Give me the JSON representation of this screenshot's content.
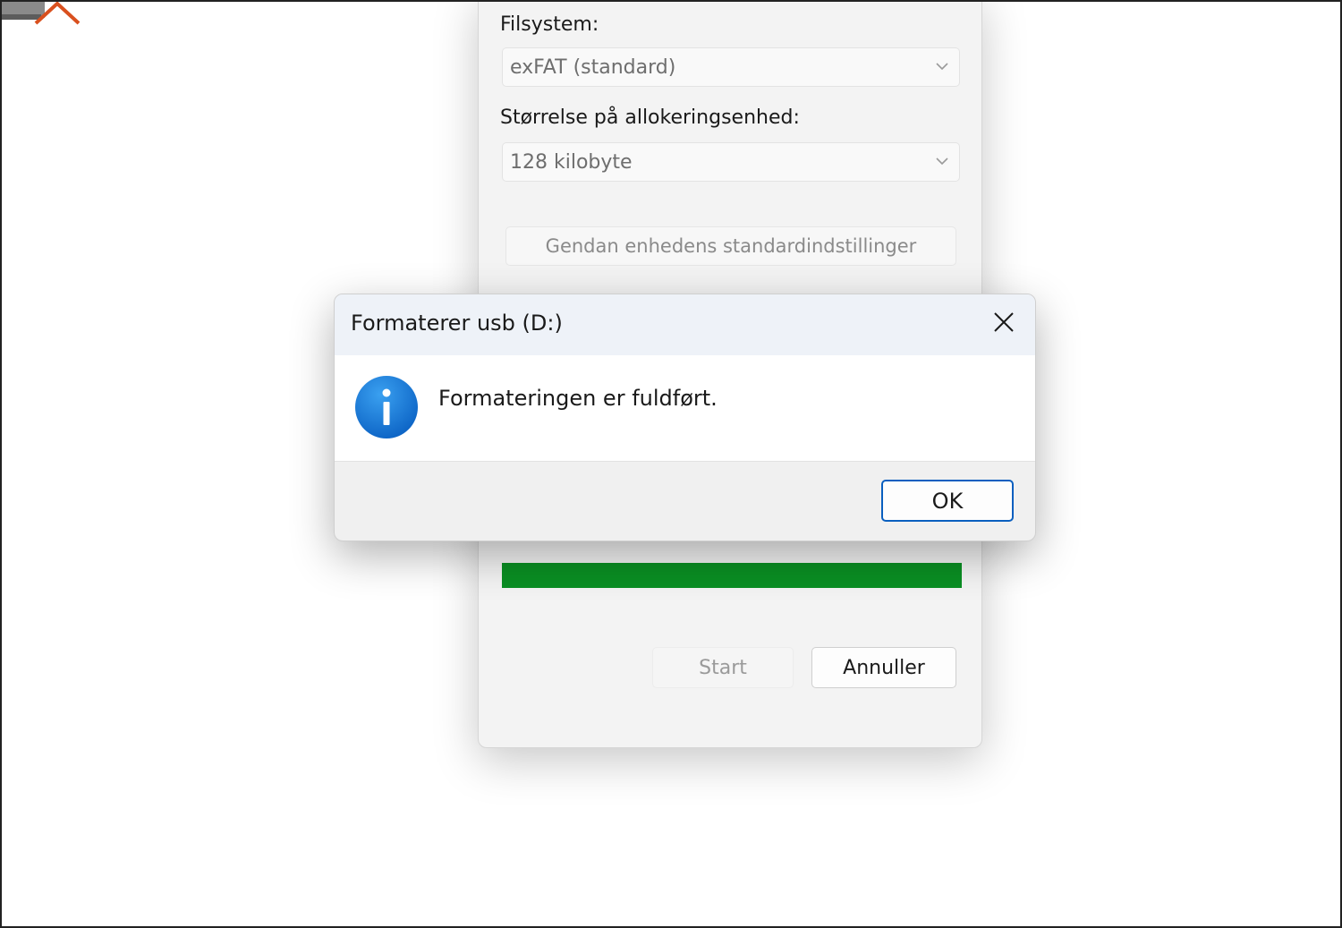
{
  "format_dialog": {
    "filesystem_label": "Filsystem:",
    "filesystem_value": "exFAT (standard)",
    "allocation_label": "Størrelse på allokeringsenhed:",
    "allocation_value": "128 kilobyte",
    "restore_defaults_label": "Gendan enhedens standardindstillinger",
    "progress_fraction": 1.0,
    "progress_color": "#0a8f23",
    "start_label": "Start",
    "cancel_label": "Annuller"
  },
  "message_box": {
    "title": "Formaterer usb (D:)",
    "message": "Formateringen er fuldført.",
    "icon": "info-icon",
    "ok_label": "OK",
    "accent_color": "#0a5fbf"
  }
}
